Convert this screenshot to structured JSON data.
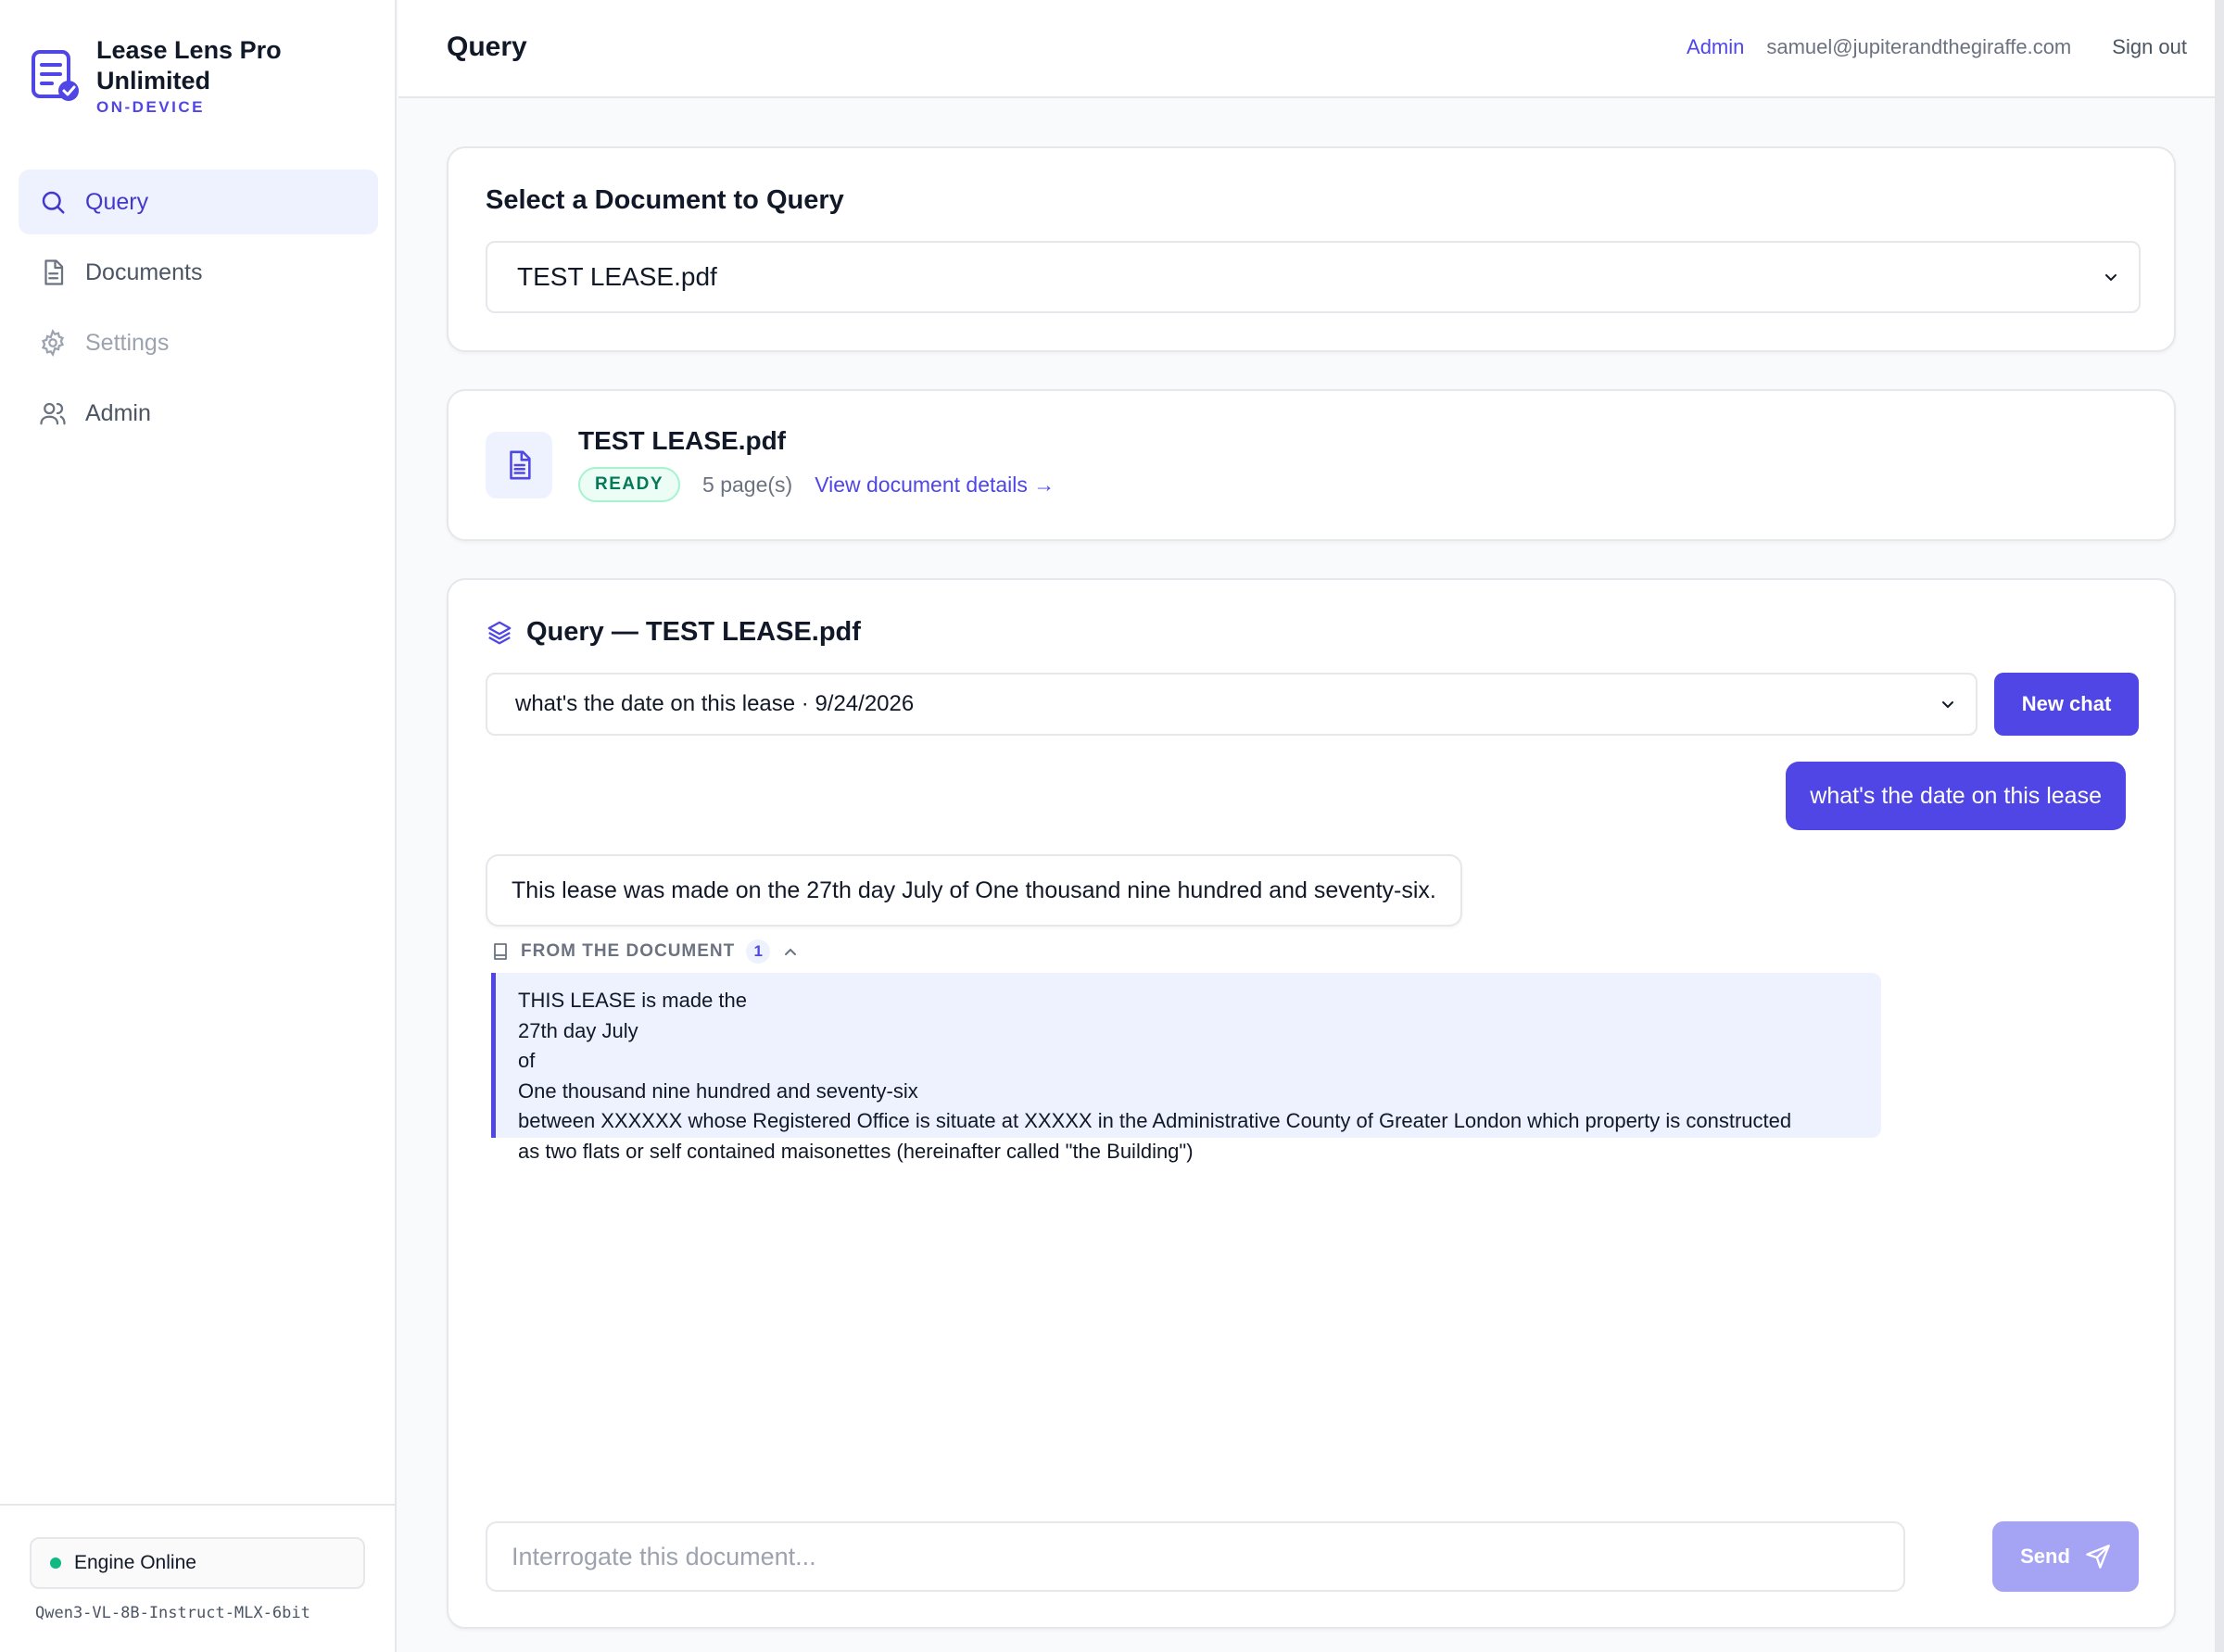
{
  "app": {
    "name": "Lease Lens Pro Unlimited",
    "tagline": "ON-DEVICE"
  },
  "sidebar": {
    "items": [
      {
        "label": "Query",
        "icon": "search-icon",
        "active": true
      },
      {
        "label": "Documents",
        "icon": "document-icon"
      },
      {
        "label": "Settings",
        "icon": "gear-icon",
        "disabled": true
      },
      {
        "label": "Admin",
        "icon": "users-icon"
      }
    ],
    "engine_status": "Engine Online",
    "model_name": "Qwen3-VL-8B-Instruct-MLX-6bit"
  },
  "header": {
    "title": "Query",
    "admin_link": "Admin",
    "email": "samuel@jupiterandthegiraffe.com",
    "sign_out": "Sign out"
  },
  "select_card": {
    "heading": "Select a Document to Query",
    "selected_document": "TEST LEASE.pdf"
  },
  "document_card": {
    "name": "TEST LEASE.pdf",
    "status": "READY",
    "pages": "5 page(s)",
    "details_link": "View document details →"
  },
  "query_card": {
    "heading": "Query — TEST LEASE.pdf",
    "chat_selector": "what's the date on this lease · 9/24/2026",
    "new_chat_label": "New chat",
    "messages": {
      "user": "what's the date on this lease",
      "assistant": "This lease was made on the 27th day July of One thousand nine hundred and seventy-six."
    },
    "sources": {
      "label": "FROM THE DOCUMENT",
      "count": "1",
      "excerpt_lines": [
        "THIS LEASE is made the",
        "27th day July",
        "of",
        "One thousand nine hundred and seventy-six",
        "between XXXXXX whose Registered Office is situate at XXXXX in the Administrative County of Greater London which property is constructed",
        "as two flats or self contained maisonettes (hereinafter called \"the Building\")"
      ]
    },
    "input_placeholder": "Interrogate this document...",
    "send_label": "Send"
  },
  "colors": {
    "accent": "#4f46e5",
    "accent_soft": "#eef2ff",
    "success": "#10b981",
    "send_disabled": "#a5a3f3"
  }
}
